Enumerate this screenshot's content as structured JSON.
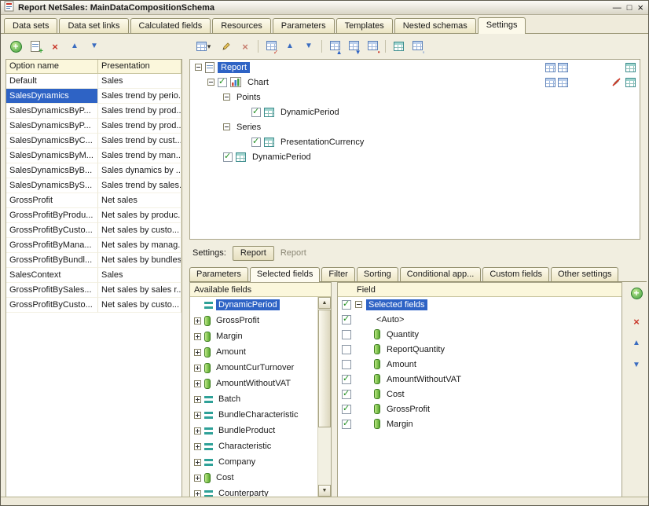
{
  "icons": {
    "minimize": "—",
    "maximize": "□",
    "close": "×",
    "add": "+",
    "delete": "×",
    "move_up": "▲",
    "move_down": "▼",
    "dropdown": "▾",
    "scroll_up": "▲",
    "scroll_down": "▼",
    "check": "✓"
  },
  "window": {
    "title": "Report NetSales: MainDataCompositionSchema"
  },
  "main_tabs": {
    "items": [
      {
        "label": "Data sets",
        "active": false
      },
      {
        "label": "Data set links",
        "active": false
      },
      {
        "label": "Calculated fields",
        "active": false
      },
      {
        "label": "Resources",
        "active": false
      },
      {
        "label": "Parameters",
        "active": false
      },
      {
        "label": "Templates",
        "active": false
      },
      {
        "label": "Nested schemas",
        "active": false
      },
      {
        "label": "Settings",
        "active": true
      }
    ]
  },
  "variants": {
    "columns": {
      "name": "Option name",
      "presentation": "Presentation"
    },
    "rows": [
      {
        "name": "Default",
        "presentation": "Sales",
        "selected": false
      },
      {
        "name": "SalesDynamics",
        "presentation": "Sales trend by perio...",
        "selected": true
      },
      {
        "name": "SalesDynamicsByP...",
        "presentation": "Sales trend by prod...",
        "selected": false
      },
      {
        "name": "SalesDynamicsByP...",
        "presentation": "Sales trend by prod...",
        "selected": false
      },
      {
        "name": "SalesDynamicsByC...",
        "presentation": "Sales trend by cust...",
        "selected": false
      },
      {
        "name": "SalesDynamicsByM...",
        "presentation": "Sales trend by man...",
        "selected": false
      },
      {
        "name": "SalesDynamicsByB...",
        "presentation": "Sales dynamics by ...",
        "selected": false
      },
      {
        "name": "SalesDynamicsByS...",
        "presentation": "Sales trend by sales...",
        "selected": false
      },
      {
        "name": "GrossProfit",
        "presentation": "Net sales",
        "selected": false
      },
      {
        "name": "GrossProfitByProdu...",
        "presentation": "Net sales by produc...",
        "selected": false
      },
      {
        "name": "GrossProfitByCusto...",
        "presentation": "Net sales by custo...",
        "selected": false
      },
      {
        "name": "GrossProfitByMana...",
        "presentation": "Net sales by manag...",
        "selected": false
      },
      {
        "name": "GrossProfitByBundl...",
        "presentation": "Net sales by bundles",
        "selected": false
      },
      {
        "name": "SalesContext",
        "presentation": "Sales",
        "selected": false
      },
      {
        "name": "GrossProfitBySales...",
        "presentation": "Net sales by sales r...",
        "selected": false
      },
      {
        "name": "GrossProfitByCusto...",
        "presentation": "Net sales by custo...",
        "selected": false
      }
    ]
  },
  "structure_tree": {
    "report": "Report",
    "chart": "Chart",
    "points": "Points",
    "points_field": "DynamicPeriod",
    "series": "Series",
    "series_field": "PresentationCurrency",
    "grouping": "DynamicPeriod",
    "checked": {
      "chart": true,
      "points_field": true,
      "series_field": true,
      "grouping": true
    }
  },
  "settings_bar": {
    "label": "Settings:",
    "root_button": "Report",
    "current": "Report"
  },
  "settings_tabs": {
    "items": [
      {
        "label": "Parameters",
        "active": false
      },
      {
        "label": "Selected fields",
        "active": true
      },
      {
        "label": "Filter",
        "active": false
      },
      {
        "label": "Sorting",
        "active": false
      },
      {
        "label": "Conditional app...",
        "active": false
      },
      {
        "label": "Custom fields",
        "active": false
      },
      {
        "label": "Other settings",
        "active": false
      }
    ]
  },
  "available_fields": {
    "header": "Available fields",
    "items": [
      {
        "label": "DynamicPeriod",
        "type": "dimension",
        "expandable": false,
        "selected": true
      },
      {
        "label": "GrossProfit",
        "type": "resource",
        "expandable": true,
        "selected": false
      },
      {
        "label": "Margin",
        "type": "resource",
        "expandable": true,
        "selected": false
      },
      {
        "label": "Amount",
        "type": "resource",
        "expandable": true,
        "selected": false
      },
      {
        "label": "AmountCurTurnover",
        "type": "resource",
        "expandable": true,
        "selected": false
      },
      {
        "label": "AmountWithoutVAT",
        "type": "resource",
        "expandable": true,
        "selected": false
      },
      {
        "label": "Batch",
        "type": "dimension",
        "expandable": true,
        "selected": false
      },
      {
        "label": "BundleCharacteristic",
        "type": "dimension",
        "expandable": true,
        "selected": false
      },
      {
        "label": "BundleProduct",
        "type": "dimension",
        "expandable": true,
        "selected": false
      },
      {
        "label": "Characteristic",
        "type": "dimension",
        "expandable": true,
        "selected": false
      },
      {
        "label": "Company",
        "type": "dimension",
        "expandable": true,
        "selected": false
      },
      {
        "label": "Cost",
        "type": "resource",
        "expandable": true,
        "selected": false
      },
      {
        "label": "Counterparty",
        "type": "dimension",
        "expandable": true,
        "selected": false
      }
    ]
  },
  "selected_fields": {
    "header": "Field",
    "root": "Selected fields",
    "root_checked": true,
    "items": [
      {
        "label": "<Auto>",
        "checked": true,
        "icon": "none"
      },
      {
        "label": "Quantity",
        "checked": false,
        "icon": "resource"
      },
      {
        "label": "ReportQuantity",
        "checked": false,
        "icon": "resource"
      },
      {
        "label": "Amount",
        "checked": false,
        "icon": "resource"
      },
      {
        "label": "AmountWithoutVAT",
        "checked": true,
        "icon": "resource"
      },
      {
        "label": "Cost",
        "checked": true,
        "icon": "resource"
      },
      {
        "label": "GrossProfit",
        "checked": true,
        "icon": "resource"
      },
      {
        "label": "Margin",
        "checked": true,
        "icon": "resource"
      }
    ]
  }
}
